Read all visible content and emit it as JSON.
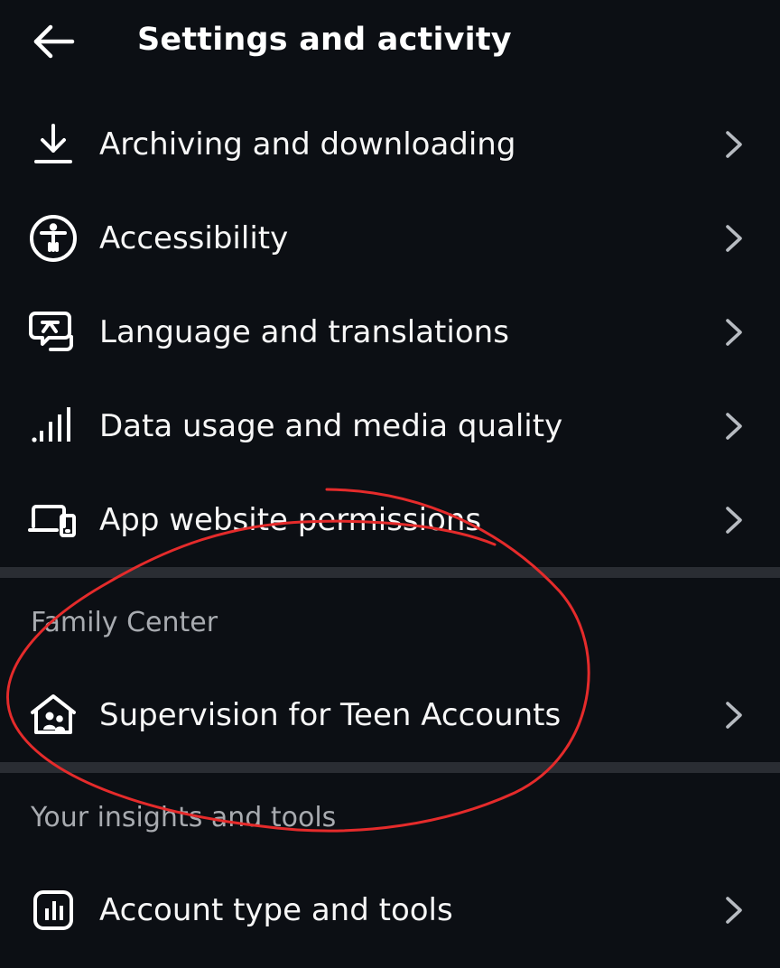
{
  "header": {
    "title": "Settings and activity",
    "back_icon": "back-arrow-icon"
  },
  "sections": [
    {
      "items": [
        {
          "label": "Archiving and downloading",
          "icon": "download-icon"
        },
        {
          "label": "Accessibility",
          "icon": "accessibility-icon"
        },
        {
          "label": "Language and translations",
          "icon": "translate-icon"
        },
        {
          "label": "Data usage and media quality",
          "icon": "signal-icon"
        },
        {
          "label": "App website permissions",
          "icon": "devices-icon"
        }
      ]
    },
    {
      "title": "Family Center",
      "items": [
        {
          "label": "Supervision for Teen Accounts",
          "icon": "family-home-icon"
        }
      ]
    },
    {
      "title": "Your insights and tools",
      "items": [
        {
          "label": "Account type and tools",
          "icon": "insights-icon"
        }
      ]
    }
  ],
  "colors": {
    "background": "#0c0f14",
    "text": "#f7f7f7",
    "muted_text": "#a8abb0",
    "divider": "#2a2d33",
    "annotation": "#e52b2b"
  }
}
